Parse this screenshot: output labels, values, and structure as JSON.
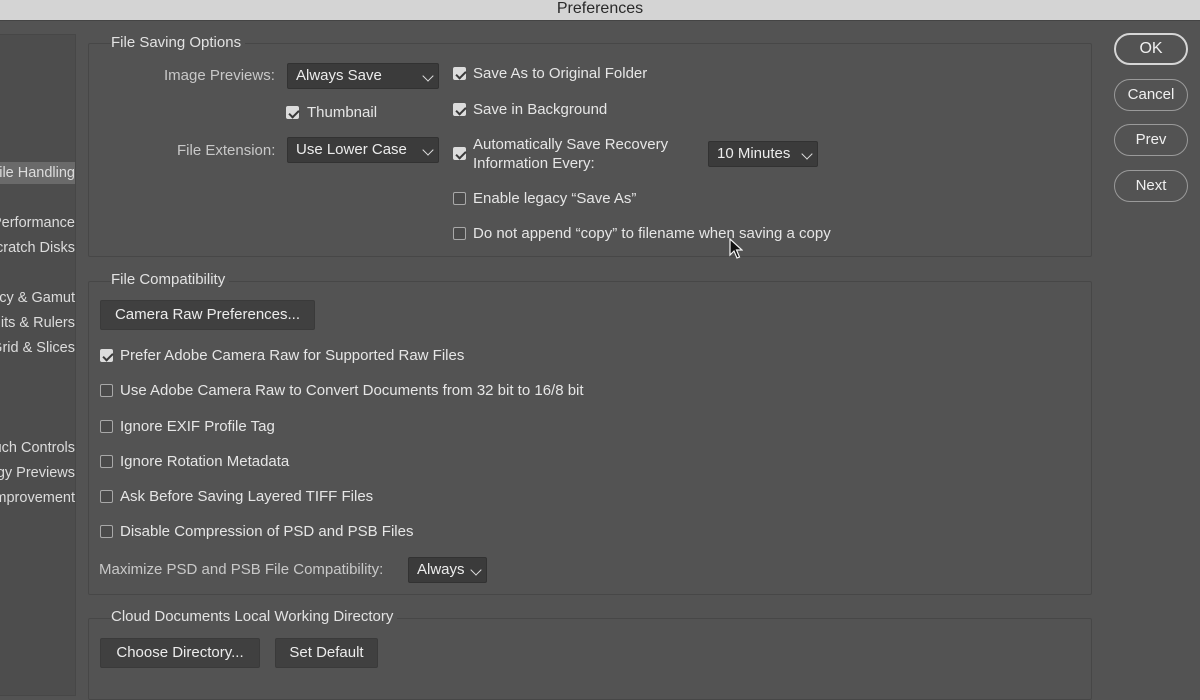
{
  "window": {
    "title": "Preferences"
  },
  "sidebar": {
    "items": [
      {
        "label": "File Handling",
        "selected": true
      },
      {
        "label": "Performance"
      },
      {
        "label": "Scratch Disks"
      },
      {
        "label": "Transparency & Gamut"
      },
      {
        "label": "Units & Rulers"
      },
      {
        "label": "Guides, Grid & Slices"
      },
      {
        "label": "Touch Controls"
      },
      {
        "label": "Technology Previews"
      },
      {
        "label": "Product Improvement"
      }
    ]
  },
  "file_saving": {
    "title": "File Saving Options",
    "image_previews_label": "Image Previews:",
    "image_previews_value": "Always Save",
    "thumbnail_label": "Thumbnail",
    "file_extension_label": "File Extension:",
    "file_extension_value": "Use Lower Case",
    "save_as_original_label": "Save As to Original Folder",
    "save_background_label": "Save in Background",
    "auto_recovery_line1": "Automatically Save Recovery",
    "auto_recovery_line2": "Information Every:",
    "auto_recovery_value": "10 Minutes",
    "legacy_save_as_label": "Enable legacy “Save As”",
    "no_copy_label": "Do not append “copy” to filename when saving a copy"
  },
  "compatibility": {
    "title": "File Compatibility",
    "camera_raw_button": "Camera Raw Preferences...",
    "prefer_acr_label": "Prefer Adobe Camera Raw for Supported Raw Files",
    "convert_32bit_label": "Use Adobe Camera Raw to Convert Documents from 32 bit to 16/8 bit",
    "ignore_exif_label": "Ignore EXIF Profile Tag",
    "ignore_rotation_label": "Ignore Rotation Metadata",
    "ask_tiff_label": "Ask Before Saving Layered TIFF Files",
    "disable_compression_label": "Disable Compression of PSD and PSB Files",
    "maximize_label": "Maximize PSD and PSB File Compatibility:",
    "maximize_value": "Always"
  },
  "cloud": {
    "title": "Cloud Documents Local Working Directory",
    "choose_button": "Choose Directory...",
    "default_button": "Set Default"
  },
  "actions": {
    "ok": "OK",
    "cancel": "Cancel",
    "prev": "Prev",
    "next": "Next"
  }
}
